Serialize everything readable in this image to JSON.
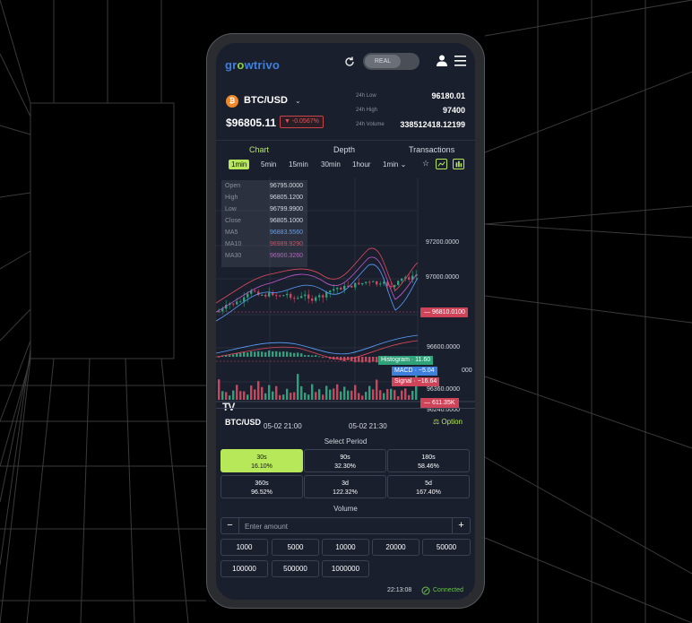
{
  "app": {
    "logo_prefix": "gr",
    "logo_o": "o",
    "logo_suffix": "wtrivo",
    "mode_label": "REAL"
  },
  "ticker": {
    "coin_symbol": "₿",
    "pair": "BTC/USD",
    "price": "$96805.11",
    "change": "▼ -0.0567%",
    "low_label": "24h Low",
    "low_value": "96180.01",
    "high_label": "24h High",
    "high_value": "97400",
    "volume_label": "24h Volume",
    "volume_value": "338512418.12199"
  },
  "tabs": [
    {
      "label": "Chart",
      "active": true
    },
    {
      "label": "Depth",
      "active": false
    },
    {
      "label": "Transactions",
      "active": false
    }
  ],
  "timeframes": [
    "1min",
    "5min",
    "15min",
    "30min",
    "1hour",
    "1min ⌄"
  ],
  "ohlc": [
    {
      "label": "Open",
      "value": "96795.0000",
      "color": "#d6d9e0"
    },
    {
      "label": "High",
      "value": "96805.1200",
      "color": "#d6d9e0"
    },
    {
      "label": "Low",
      "value": "96799.9900",
      "color": "#d6d9e0"
    },
    {
      "label": "Close",
      "value": "96805.1000",
      "color": "#d6d9e0"
    },
    {
      "label": "MA5",
      "value": "96883.5560",
      "color": "#5aa0ff"
    },
    {
      "label": "MA10",
      "value": "96989.9290",
      "color": "#e04a5a"
    },
    {
      "label": "MA30",
      "value": "96900.3260",
      "color": "#c65ad0"
    }
  ],
  "chart": {
    "price_ticks": [
      "97200.0000",
      "97000.0000",
      "96600.0000"
    ],
    "current_price": "96810.0100",
    "indicators": [
      {
        "label": "Histogram",
        "value": "11.60",
        "color": "#2fa27a"
      },
      {
        "label": "MACD",
        "value": "−5.04",
        "color": "#3f7fdc"
      },
      {
        "label": "Signal",
        "value": "−16.64",
        "color": "#d0445a"
      }
    ],
    "macd_tick": "000",
    "volume_ticks": [
      "96360.0000",
      "96240.0000"
    ],
    "volume_badge": "611.35K",
    "time_labels": [
      "05-02 21:00",
      "05-02 21:30"
    ],
    "watermark": "TV"
  },
  "trade": {
    "pair": "BTC/USD",
    "option_label": "Option",
    "select_period_label": "Select Period",
    "periods": [
      {
        "time": "30s",
        "payout": "16.10%",
        "active": true
      },
      {
        "time": "90s",
        "payout": "32.30%",
        "active": false
      },
      {
        "time": "180s",
        "payout": "58.46%",
        "active": false
      },
      {
        "time": "360s",
        "payout": "96.52%",
        "active": false
      },
      {
        "time": "3d",
        "payout": "122.32%",
        "active": false
      },
      {
        "time": "5d",
        "payout": "167.40%",
        "active": false
      }
    ],
    "volume_label": "Volume",
    "amount_placeholder": "Enter amount",
    "quick_amounts": [
      "1000",
      "5000",
      "10000",
      "20000",
      "50000",
      "100000",
      "500000",
      "1000000"
    ]
  },
  "status": {
    "time": "22:13:08",
    "connection": "Connected"
  }
}
